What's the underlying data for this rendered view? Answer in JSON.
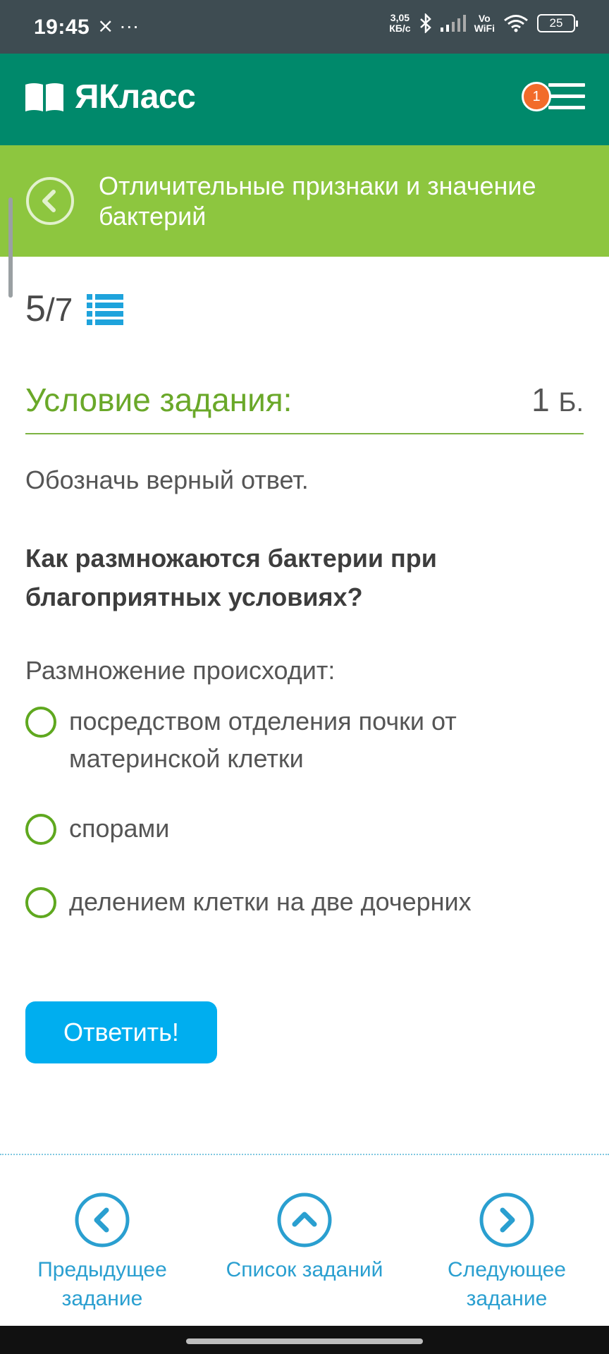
{
  "status_bar": {
    "time": "19:45",
    "left_icons": "⨯ ···",
    "net_speed_value": "3,05",
    "net_speed_unit": "КБ/с",
    "vowifi_top": "Vo",
    "vowifi_bottom": "WiFi",
    "battery": "25"
  },
  "header": {
    "logo_text": "ЯКласс",
    "notification_count": "1"
  },
  "topic": {
    "title": "Отличительные признаки и значение бактерий"
  },
  "progress": {
    "current": "5",
    "total": "/7"
  },
  "task": {
    "condition_title": "Условие задания:",
    "points_value": "1",
    "points_unit": "Б.",
    "instruction": "Обозначь верный ответ.",
    "question": "Как размножаются бактерии при благоприятных условиях?",
    "prompt": "Размножение происходит:",
    "options": [
      "посредством отделения почки от материнской клетки",
      "спорами",
      "делением клетки на две дочерних"
    ],
    "answer_label": "Ответить!"
  },
  "bottom_nav": {
    "prev_label": "Предыдущее задание",
    "list_label": "Список заданий",
    "next_label": "Следующее задание"
  },
  "colors": {
    "header_green": "#00896b",
    "topic_green": "#8dc63f",
    "accent_blue": "#00aeef",
    "radio_green": "#5fa81f"
  }
}
